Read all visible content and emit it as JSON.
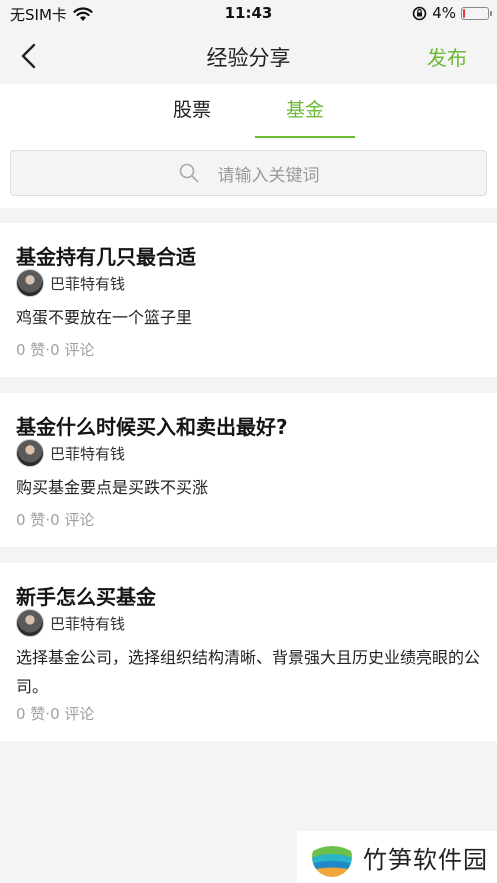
{
  "status_bar": {
    "carrier": "无SIM卡",
    "time": "11:43",
    "battery": "4%",
    "battery_level": 0.04,
    "wifi_icon": "wifi-icon",
    "rotation_lock_icon": "rotation-lock-icon"
  },
  "nav": {
    "back_icon": "chevron-left-icon",
    "title": "经验分享",
    "publish_label": "发布"
  },
  "tabs": [
    {
      "label": "股票",
      "active": false
    },
    {
      "label": "基金",
      "active": true
    }
  ],
  "search": {
    "placeholder": "请输入关键词",
    "icon": "search-icon"
  },
  "posts": [
    {
      "title": "基金持有几只最合适",
      "author": "巴菲特有钱",
      "summary": "鸡蛋不要放在一个篮子里",
      "stats": "0 赞·0 评论"
    },
    {
      "title": "基金什么时候买入和卖出最好?",
      "author": "巴菲特有钱",
      "summary": "购买基金要点是买跌不买涨",
      "stats": "0 赞·0 评论"
    },
    {
      "title": "新手怎么买基金",
      "author": "巴菲特有钱",
      "summary": "选择基金公司，选择组织结构清晰、背景强大且历史业绩亮眼的公司。",
      "stats": "0 赞·0 评论"
    }
  ],
  "watermark": {
    "text": "竹笋软件园"
  },
  "colors": {
    "accent": "#6cb936",
    "background": "#f4f4f4",
    "battery_low": "#e53935"
  }
}
